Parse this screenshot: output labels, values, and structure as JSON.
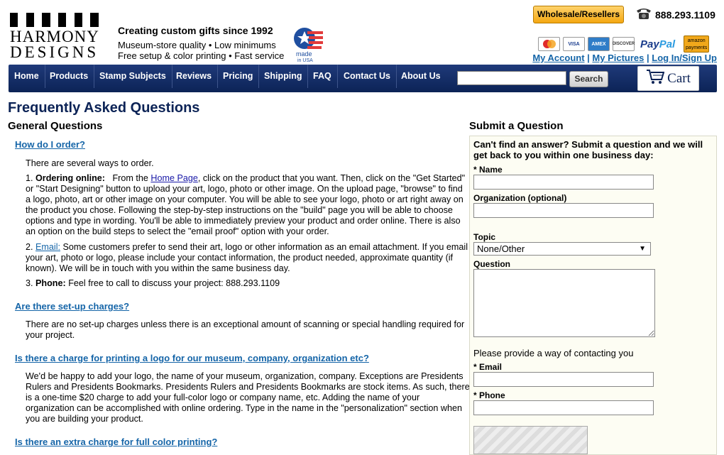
{
  "header": {
    "logo_line1": "HARMONY",
    "logo_line2": "DESIGNS",
    "tagline": "Creating custom gifts since 1992",
    "tag2": "Museum-store quality • Low minimums",
    "tag3": "Free setup & color printing • Fast service",
    "made_in_usa": "made in USA",
    "wholesale_label": "Wholesale/Resellers",
    "phone": "888.293.1109",
    "cards": [
      "MasterCard",
      "VISA",
      "AMEX",
      "DISCOVER"
    ],
    "paypal": "PayPal",
    "amazon": "amazon payments",
    "links": [
      "My Account",
      "My Pictures",
      "Log In/Sign Up"
    ]
  },
  "nav": {
    "items": [
      "Home",
      "Products",
      "Stamp Subjects",
      "Reviews",
      "Pricing",
      "Shipping",
      "FAQ",
      "Contact Us",
      "About Us"
    ],
    "search_placeholder": "",
    "search_button": "Search",
    "cart_label": "Cart"
  },
  "main": {
    "title": "Frequently Asked Questions",
    "section": "General Questions",
    "faqs": [
      {
        "question": "How do I order?",
        "intro": "There are several ways to order.",
        "p1_num": "1.",
        "p1_bold": "Ordering online:",
        "p1_pre": "From the",
        "p1_link": "Home Page",
        "p1_text": ", click on the product that you want.  Then, click on the \"Get Started\"  or \"Start Designing\" button to upload your art, logo, photo or other image. On the upload page, \"browse\" to find a logo, photo, art or other image on your computer.   You will be able to see your logo, photo or art right away on the product you chose.  Following the step-by-step instructions on the \"build\" page you will be able to choose options and type in wording. You'll be able to immediately preview your product and order online.  There is also an option on the build steps to select the \"email proof\" option with your order.",
        "p2_num": "2.",
        "p2_link": "Email:",
        "p2_text": " Some customers prefer to send their art, logo or other information as an email attachment.  If you email your art, photo or logo, please include your contact information, the product needed, approximate quantity (if known). We will be in touch with you within the same business day.",
        "p3_num": "3.",
        "p3_bold": "Phone:",
        "p3_text": "  Feel free to call to discuss your project:  888.293.1109"
      },
      {
        "question": "Are there set-up charges?",
        "answer": "There are no set-up charges unless there is an exceptional amount of scanning or special handling required for your project."
      },
      {
        "question": "Is there a charge for printing a logo for our museum, company, organization etc?",
        "answer": "We'd be happy to add your logo,  the name of your museum, organization, company.  Exceptions are Presidents Rulers and Presidents Bookmarks.  Presidents Rulers and Presidents Bookmarks are stock items.  As such, there is a one-time $20 charge to add your full-color logo or company name, etc.   Adding the name of your organization can be accomplished with online ordering.  Type in the name in the \"personalization\" section when you are building your product."
      },
      {
        "question": "Is there an extra charge for full color printing?"
      }
    ]
  },
  "form": {
    "title": "Submit a Question",
    "intro": "Can't find an answer? Submit a question and we will get back to you within one business day:",
    "name_label": "* Name",
    "org_label": "Organization (optional)",
    "topic_label": "Topic",
    "topic_value": "None/Other",
    "question_label": "Question",
    "contact_note": "Please provide a way of contacting you",
    "email_label": "* Email",
    "phone_label": "* Phone"
  }
}
